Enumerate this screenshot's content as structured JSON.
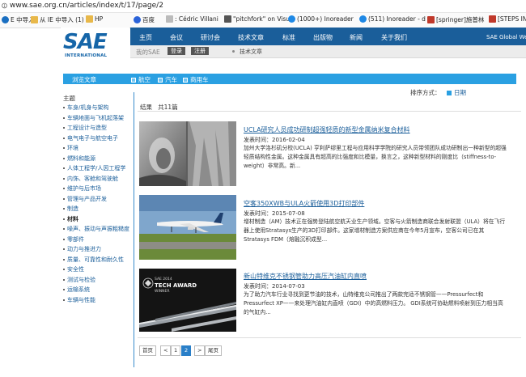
{
  "browser": {
    "url": "www.sae.org.cn/articles/index/t/17/page/2",
    "bookmarks": [
      {
        "label": "E 中导入",
        "icon": "ie-icon",
        "color": "#1a6fc1"
      },
      {
        "label": "从 IE 中导入 (1)",
        "icon": "folder-icon",
        "color": "#e8b84a"
      },
      {
        "label": "HP",
        "icon": "folder-icon",
        "color": "#e8b84a"
      },
      {
        "label": "百度",
        "icon": "baidu-icon",
        "color": "#2b63d9"
      },
      {
        "label": ": Cédric Villani",
        "icon": "page-icon",
        "color": "#888888"
      },
      {
        "label": "\"pitchfork\" on Visu",
        "icon": "page-icon",
        "color": "#555555"
      },
      {
        "label": "(1000+) Inoreader",
        "icon": "inoreader-icon",
        "color": "#1e88e5"
      },
      {
        "label": "(511) Inoreader - d",
        "icon": "inoreader-icon",
        "color": "#1e88e5"
      },
      {
        "label": "[springer]施普林",
        "icon": "springer-icon",
        "color": "#c0392b"
      },
      {
        "label": "[STEPS IN",
        "icon": "steps-icon",
        "color": "#c0392b"
      }
    ]
  },
  "header": {
    "logo_text": "SAE",
    "logo_sub": "INTERNATIONAL",
    "nav": [
      "主页",
      "会议",
      "研讨会",
      "技术文章",
      "标准",
      "出版物",
      "新闻",
      "关于我们"
    ],
    "global": "SAE Global We",
    "mysae": "我的SAE",
    "login": "登录",
    "register": "注册",
    "sub_section": "技术文章"
  },
  "browse": {
    "title": "浏览文章",
    "categories": [
      "航空",
      "汽车",
      "商用车"
    ]
  },
  "sidebar": {
    "heading": "主题",
    "topics": [
      "车身/机身与架构",
      "车辆地面与飞机起落架",
      "工程设计与造型",
      "电气电子与航空电子",
      "环境",
      "燃料和能源",
      "人体工程学/人因工程学",
      "内饰、客舱和驾驶舱",
      "维护与后市场",
      "管理与产品开发",
      "制造",
      "材料",
      "噪声、振动与声振粗糙度",
      "零部件",
      "动力与推进力",
      "质量、可靠性和耐久性",
      "安全性",
      "测试与检验",
      "运输系统",
      "车辆与性能"
    ],
    "active_topic": "材料"
  },
  "main": {
    "sort_label": "排序方式：",
    "sort_value": "日期",
    "results_prefix": "结果",
    "results_count": "共11篇",
    "date_prefix": "发表时间：",
    "articles": [
      {
        "title": "UCLA研究人员成功研制超强轻质的新型金属纳米复合材料",
        "date": "2016-02-04",
        "summary": "加州大学洛杉矶分校(UCLA) 亨利萨缪里工程与应用科学学院的研究人员带领团队成功研制出一种新型的超强轻质结构性金属。这种金属具有超高的比强度和比模量，换言之，这种新型材料的刚度比（stiffness-to-weight）非常高。新..."
      },
      {
        "title": "空客350XWB与ULA火箭使用3D打印部件",
        "date": "2015-07-08",
        "summary": "增材制造（AM）技术正在强势登陆航空航天业生产领域。空客与火箭制造商联合发射联盟（ULA）将在飞行器上使用Stratasys生产的3D打印部件。这家增材制造方案供应商在今年5月宣布，空客公司已在其Stratasys FDM（熔融沉积成型..."
      },
      {
        "title": "新山特维克不锈钢管助力高压汽油缸内直喷",
        "date": "2014-07-03",
        "summary": "为了助力汽车行业寻找到更节油的技术，山特维克公司推出了两款完适不锈钢管——Pressurfect和Pressurfect XP——来处理汽油缸内直喷（GDI）中的高燃料压力。 GDI系统可协助燃料喷射到压力相当高的气缸内...",
        "badge_line1": "SAE 2014",
        "badge_line2": "TECH AWARD",
        "badge_line3": "WINNER"
      }
    ]
  },
  "pagination": {
    "first": "首页",
    "prev": "<",
    "pages": [
      "1",
      "2"
    ],
    "current": "2",
    "next": ">",
    "last": "尾页"
  }
}
